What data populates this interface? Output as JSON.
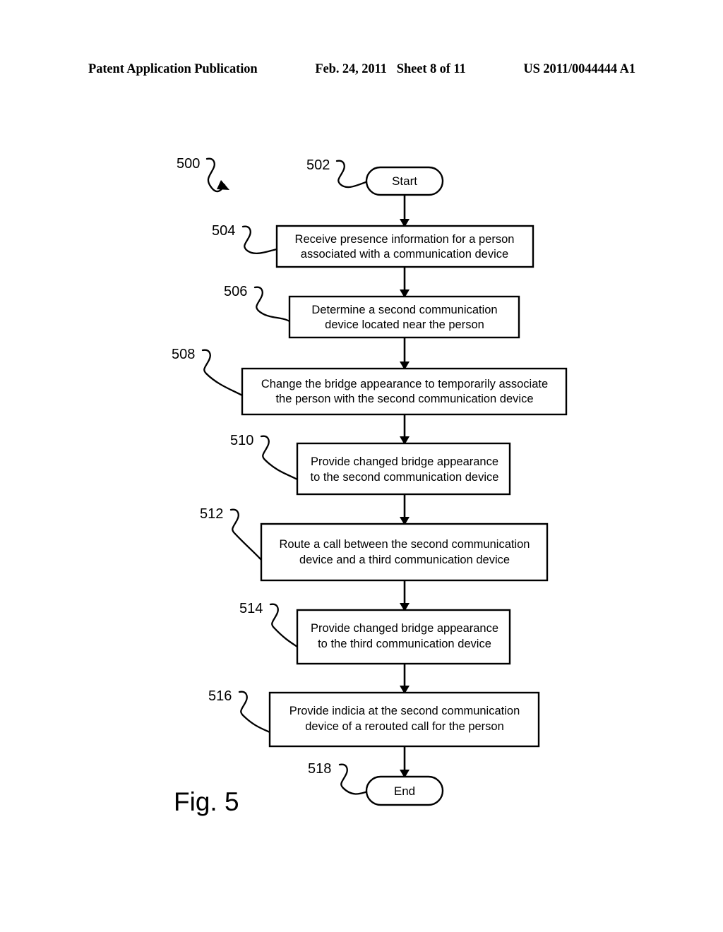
{
  "header": {
    "left": "Patent Application Publication",
    "date": "Feb. 24, 2011",
    "sheet": "Sheet 8 of 11",
    "pubnum": "US 2011/0044444 A1"
  },
  "figure": {
    "caption": "Fig. 5",
    "diagram_ref": "500"
  },
  "flowchart": {
    "nodes": [
      {
        "ref": "502",
        "type": "terminal",
        "label": "Start"
      },
      {
        "ref": "504",
        "type": "process",
        "line1": "Receive presence information for a person",
        "line2": "associated with a communication device"
      },
      {
        "ref": "506",
        "type": "process",
        "line1": "Determine a second communication",
        "line2": "device located near the person"
      },
      {
        "ref": "508",
        "type": "process",
        "line1": "Change the bridge appearance to temporarily associate",
        "line2": "the person with the second communication device"
      },
      {
        "ref": "510",
        "type": "process",
        "line1": "Provide changed bridge appearance",
        "line2": "to the second communication device"
      },
      {
        "ref": "512",
        "type": "process",
        "line1": "Route a call between the second communication",
        "line2": "device and a third communication device"
      },
      {
        "ref": "514",
        "type": "process",
        "line1": "Provide changed bridge appearance",
        "line2": "to the third communication device"
      },
      {
        "ref": "516",
        "type": "process",
        "line1": "Provide indicia at the second communication",
        "line2": "device of a rerouted call for the person"
      },
      {
        "ref": "518",
        "type": "terminal",
        "label": "End"
      }
    ]
  },
  "colors": {
    "ink": "#000000",
    "paper": "#ffffff"
  }
}
